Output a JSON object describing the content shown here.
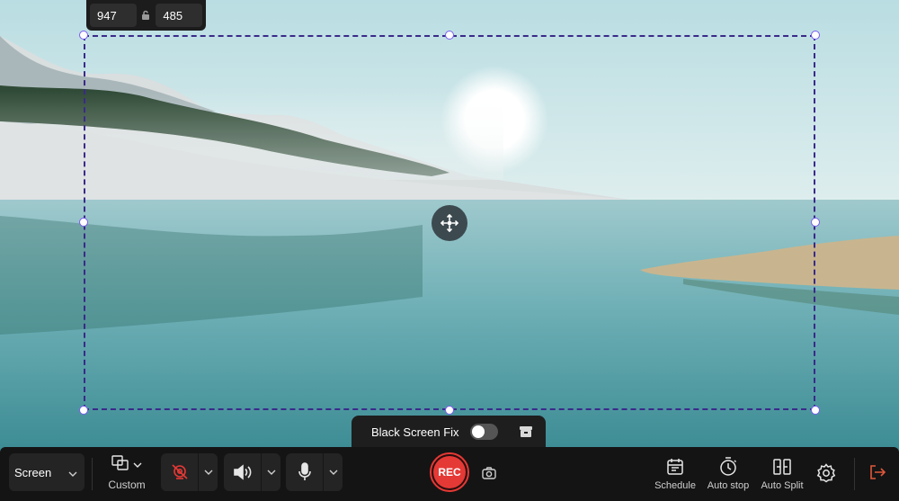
{
  "selection": {
    "width": "947",
    "height": "485"
  },
  "black_screen_fix": {
    "label": "Black Screen Fix",
    "enabled": false
  },
  "toolbar": {
    "source": "Screen",
    "region_label": "Custom",
    "webcam": "off",
    "rec_label": "REC",
    "schedule_label": "Schedule",
    "autostop_label": "Auto stop",
    "autosplit_label": "Auto Split"
  },
  "colors": {
    "accent": "#7a5cf0",
    "rec": "#e53935",
    "toolbar_bg": "#141414",
    "exit": "#e0583a"
  },
  "icons": [
    "lock-icon",
    "move-icon",
    "archive-icon",
    "chevron-down-icon",
    "region-icon",
    "webcam-off-icon",
    "speaker-icon",
    "microphone-icon",
    "camera-icon",
    "calendar-icon",
    "timer-icon",
    "split-icon",
    "gear-icon",
    "exit-icon"
  ]
}
